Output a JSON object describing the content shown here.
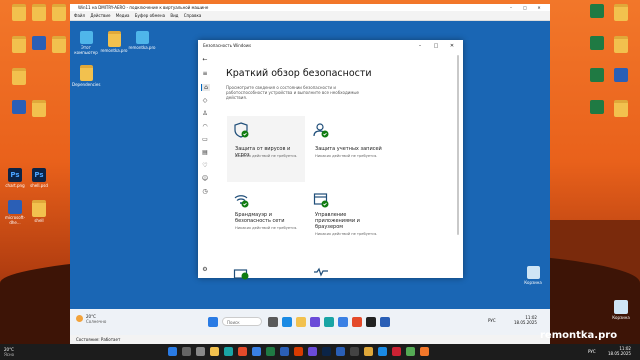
{
  "host_desktop": {
    "icons": [
      {
        "label": "",
        "icon": "folder-icon"
      },
      {
        "label": "",
        "icon": "folder-icon"
      },
      {
        "label": "",
        "icon": "folder-icon"
      },
      {
        "label": "",
        "icon": "word-icon"
      },
      {
        "label": "",
        "icon": "folder-icon"
      },
      {
        "label": "",
        "icon": "folder-icon"
      },
      {
        "label": "",
        "icon": "word-icon"
      },
      {
        "label": "",
        "icon": "folder-icon"
      },
      {
        "label": "",
        "icon": "folder-icon"
      },
      {
        "label": "chart.png",
        "icon": "ps-icon"
      },
      {
        "label": "shell.psd",
        "icon": "ps-icon"
      },
      {
        "label": "microsoft-dhe...",
        "icon": "word-icon"
      },
      {
        "label": "shell",
        "icon": "folder-icon"
      }
    ],
    "right_icons": [
      {
        "label": "",
        "icon": "excel-icon"
      },
      {
        "label": "",
        "icon": "folder-icon"
      },
      {
        "label": "",
        "icon": "excel-icon"
      },
      {
        "label": "",
        "icon": "folder-icon"
      },
      {
        "label": "",
        "icon": "excel-icon"
      },
      {
        "label": "",
        "icon": "word-icon"
      },
      {
        "label": "",
        "icon": "excel-icon"
      },
      {
        "label": "",
        "icon": "folder-icon"
      },
      {
        "label": "Корзина",
        "icon": "recycle-bin-icon"
      }
    ],
    "watermark": "remontka.pro"
  },
  "vm_window": {
    "title": "Win11 на DMITRY-AERO - подключение к виртуальной машине",
    "menu": [
      "Файл",
      "Действие",
      "Медиа",
      "Буфер обмена",
      "Вид",
      "Справка"
    ],
    "desktop_icons": [
      {
        "label": "Этот компьютер",
        "icon": "pc-icon"
      },
      {
        "label": "remontka.pro",
        "icon": "folder-icon"
      },
      {
        "label": "remontka.pro",
        "icon": "pc-icon"
      },
      {
        "label": "Dependencies",
        "icon": "folder-icon"
      }
    ],
    "recycle_bin": "Корзина"
  },
  "security_app": {
    "window_title": "Безопасность Windows",
    "heading": "Краткий обзор безопасности",
    "intro": "Просмотрите сведения о состоянии безопасности и работоспособности устройства и выполните все необходимые действия.",
    "cards": [
      {
        "title": "Защита от вирусов и угроз",
        "status": "Никаких действий не требуется.",
        "icon": "shield-check-icon"
      },
      {
        "title": "Защита учетных записей",
        "status": "Никаких действий не требуется.",
        "icon": "account-check-icon"
      },
      {
        "title": "Брандмауэр и безопасность сети",
        "status": "Никаких действий не требуется.",
        "icon": "wifi-check-icon"
      },
      {
        "title": "Управление приложениями и браузером",
        "status": "Никаких действий не требуется.",
        "icon": "app-browser-check-icon"
      }
    ]
  },
  "vm_taskbar": {
    "weather_temp": "20°C",
    "weather_desc": "Солнечно",
    "search_placeholder": "Поиск",
    "lang": "РУС",
    "time": "11:02",
    "date": "18.05.2025",
    "status": "Состояние: Работает"
  },
  "host_taskbar": {
    "weather_temp": "20°C",
    "weather_desc": "Ясно",
    "lang": "РУС",
    "time": "11:02",
    "date": "18.05.2025"
  }
}
